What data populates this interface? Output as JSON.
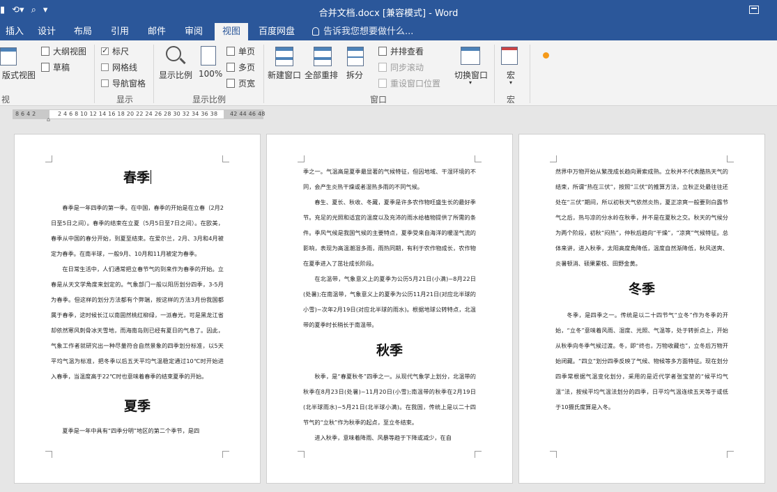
{
  "window": {
    "title": "合并文档.docx [兼容模式] - Word"
  },
  "tabs": [
    {
      "label": "插入"
    },
    {
      "label": "设计"
    },
    {
      "label": "布局"
    },
    {
      "label": "引用"
    },
    {
      "label": "邮件"
    },
    {
      "label": "审阅"
    },
    {
      "label": "视图"
    },
    {
      "label": "百度网盘"
    }
  ],
  "active_tab": "视图",
  "tell_me": "告诉我您想要做什么...",
  "ribbon": {
    "views": {
      "outline": "大纲视图",
      "draft": "草稿",
      "web_layout": "版式视图",
      "group_label": "视图"
    },
    "show": {
      "ruler": "标尺",
      "gridlines": "网格线",
      "nav_pane": "导航窗格",
      "group_label": "显示"
    },
    "zoom": {
      "zoom": "显示比例",
      "hundred": "100%",
      "one_page": "单页",
      "multi_page": "多页",
      "page_width": "页宽",
      "group_label": "显示比例"
    },
    "window": {
      "new_window": "新建窗口",
      "arrange_all": "全部重排",
      "split": "拆分",
      "side_by_side": "并排查看",
      "sync_scroll": "同步滚动",
      "reset_pos": "重设窗口位置",
      "switch_window": "切换窗口",
      "group_label": "窗口"
    },
    "macros": {
      "macro": "宏",
      "group_label": "宏"
    }
  },
  "ruler": {
    "left_nums": "8 6 4 2",
    "mid_nums": "2 4 6 8 10 12 14 16 18 20 22 24 26 28 30 32 34 36 38",
    "right_nums": "42 44 46 48"
  },
  "pages": {
    "p1": {
      "heading1": "春季",
      "para1": "春季是一年四季的第一季。在中国，春季的开始是在立春（2月2日至5日之间）。春季的结束在立夏（5月5日至7日之间）。在欧美，春季从中国的春分开始，到夏至结束。在爱尔兰，2月、3月和4月被定为春季。在南半球，一般9月、10月和11月被定为春季。",
      "para2": "在日常生活中，人们通常把立春节气的到来作为春季的开始。立春是从天文学角度来划定的。气象部门一般以阳历划分四季，3-5月为春季。但这样的划分方法都有个弊端，按这样的方法3月份我国都属于春季，这时候长江以南固然桃红柳绿，一派春光，可是黑龙江省却依然寒风刺骨冰天雪地，而海南岛则已经有夏日的气息了。因此，气象工作者就研究出一种尽量符合自然景象的四季划分标准，以5天平均气温为标准，把冬季以后五天平均气温稳定通过10℃时开始进入春季，当温度高于22℃时也意味着春季的结束夏季的开始。",
      "heading2": "夏季",
      "para3": "夏季是一年中具有“四季分明”地区的第二个季节，是四"
    },
    "p2": {
      "para1": "季之一。气温高是夏季最显著的气候特征，但因地域、干湿环境的不同，会产生炎热干燥或者湿热多雨的不同气候。",
      "para2": "春生、夏长、秋收、冬藏，夏季是许多农作物旺盛生长的最好季节。充足的光照和适宜的温度以及充沛的雨水给植物提供了所需的条件。季风气候是我国气候的主要特点，夏季受来自海洋的暖湿气流的影响，表现为高温潮湿多雨，雨热同期，有利于农作物成长，农作物在夏季进入了茁壮成长阶段。",
      "para3": "在北温带，气象意义上的夏季为公历5月21日(小满)~8月22日(处暑);在南温带，气象意义上的夏季为公历11月21日(对应北半球的小雪)~次年2月19日(对应北半球的雨水)。根据地球公转特点，北温带的夏季时长稍长于南温带。",
      "heading": "秋季",
      "para4": "秋季，是“春夏秋冬”四季之一。从现代气象学上划分，北温带的秋季在8月23日(处暑)~11月20日(小雪);南温带的秋季在2月19日(北半球雨水)~5月21日(北半球小满)。在我国，传统上是以二十四节气的“立秋”作为秋季的起点，至立冬结束。",
      "para5": "进入秋季，意味着降雨、风暴等趋于下降或减少，在自"
    },
    "p3": {
      "para1": "然界中万物开始从繁茂成长趋向萧索成熟。立秋并不代表酷热天气的结束，所谓“热在三伏”，按照“三伏”的推算方法，立秋正处最往往还处在“三伏”期间，所以初秋天气依然炎热，夏正凉爽一般要到白露节气之后，热与凉的分水岭在秋季，并不是在夏秋之交。秋天的气候分为两个阶段，初秋“闷热”，仲秋后趋向“干燥”，“凉爽”气候特征。总体来讲，进入秋季，太阳高度角降低，温度自然渐降低，秋风送爽、炎暑顿消、硕果累枝、田野金黄。",
      "heading": "冬季",
      "para2": "冬季，是四季之一。传统是以二十四节气“立冬”作为冬季的开始，“立冬”意味着风雨、湿度、光照、气温等，处于转折点上，开始从秋季向冬季气候过渡。冬，即“终也，万物收藏也”，立冬后万物开始闭藏。“四立”划分四季反映了气候、物候等多方面特征。现在划分四季常根据气温变化划分，采用的是近代学者张宝堃的“候平均气温”法，按候平均气温法划分的四季，日平均气温连续五天等于或低于10摄氏度算是入冬。"
    }
  }
}
